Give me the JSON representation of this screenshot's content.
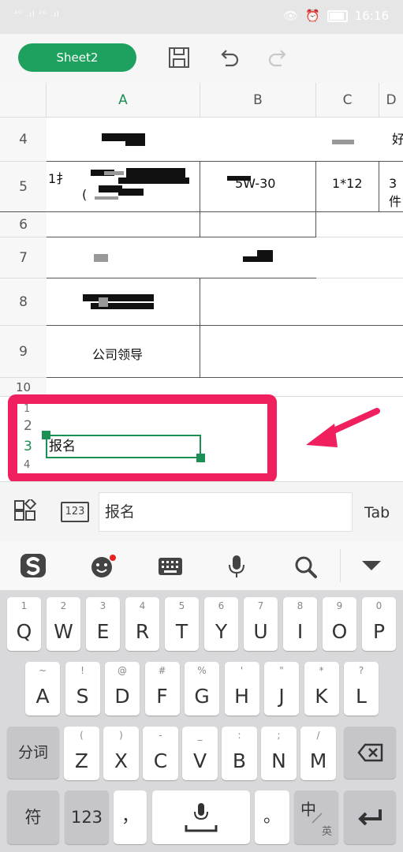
{
  "status": {
    "signal_left": "⁴ᴳ .ıl ²ᴳ .ıl",
    "time": "16:16"
  },
  "toolbar": {
    "sheet_tab": "Sheet2"
  },
  "sheet": {
    "columns": [
      "A",
      "B",
      "C",
      "D"
    ],
    "rows": [
      "4",
      "5",
      "6",
      "7",
      "8",
      "9",
      "10"
    ],
    "row5": {
      "a_prefix": "1扌",
      "a_paren": "(",
      "b": "5W-30",
      "c": "1*12",
      "d": "3件"
    },
    "row4": {
      "d": "好"
    },
    "row9": {
      "a": "公司领导"
    },
    "small_rows": [
      "1",
      "2",
      "3",
      "4"
    ]
  },
  "active_cell": {
    "value": "报名"
  },
  "formula_bar": {
    "value": "报名",
    "tab_label": "Tab",
    "num_label": "123"
  },
  "keyboard": {
    "row1": [
      {
        "k": "Q",
        "s": "1"
      },
      {
        "k": "W",
        "s": "2"
      },
      {
        "k": "E",
        "s": "3"
      },
      {
        "k": "R",
        "s": "4"
      },
      {
        "k": "T",
        "s": "5"
      },
      {
        "k": "Y",
        "s": "6"
      },
      {
        "k": "U",
        "s": "7"
      },
      {
        "k": "I",
        "s": "8"
      },
      {
        "k": "O",
        "s": "9"
      },
      {
        "k": "P",
        "s": "0"
      }
    ],
    "row2": [
      {
        "k": "A",
        "s": "~"
      },
      {
        "k": "S",
        "s": "!"
      },
      {
        "k": "D",
        "s": "@"
      },
      {
        "k": "F",
        "s": "#"
      },
      {
        "k": "G",
        "s": "%"
      },
      {
        "k": "H",
        "s": "'"
      },
      {
        "k": "J",
        "s": "\""
      },
      {
        "k": "K",
        "s": "*"
      },
      {
        "k": "L",
        "s": "?"
      }
    ],
    "row3": [
      {
        "k": "Z",
        "s": "("
      },
      {
        "k": "X",
        "s": ")"
      },
      {
        "k": "C",
        "s": "-"
      },
      {
        "k": "V",
        "s": "_"
      },
      {
        "k": "B",
        "s": ":"
      },
      {
        "k": "N",
        "s": ";"
      },
      {
        "k": "M",
        "s": "/"
      }
    ],
    "fenci": "分词",
    "fu": "符",
    "num": "123",
    "comma": "，",
    "period": "。",
    "zh": "中",
    "en": "英"
  }
}
